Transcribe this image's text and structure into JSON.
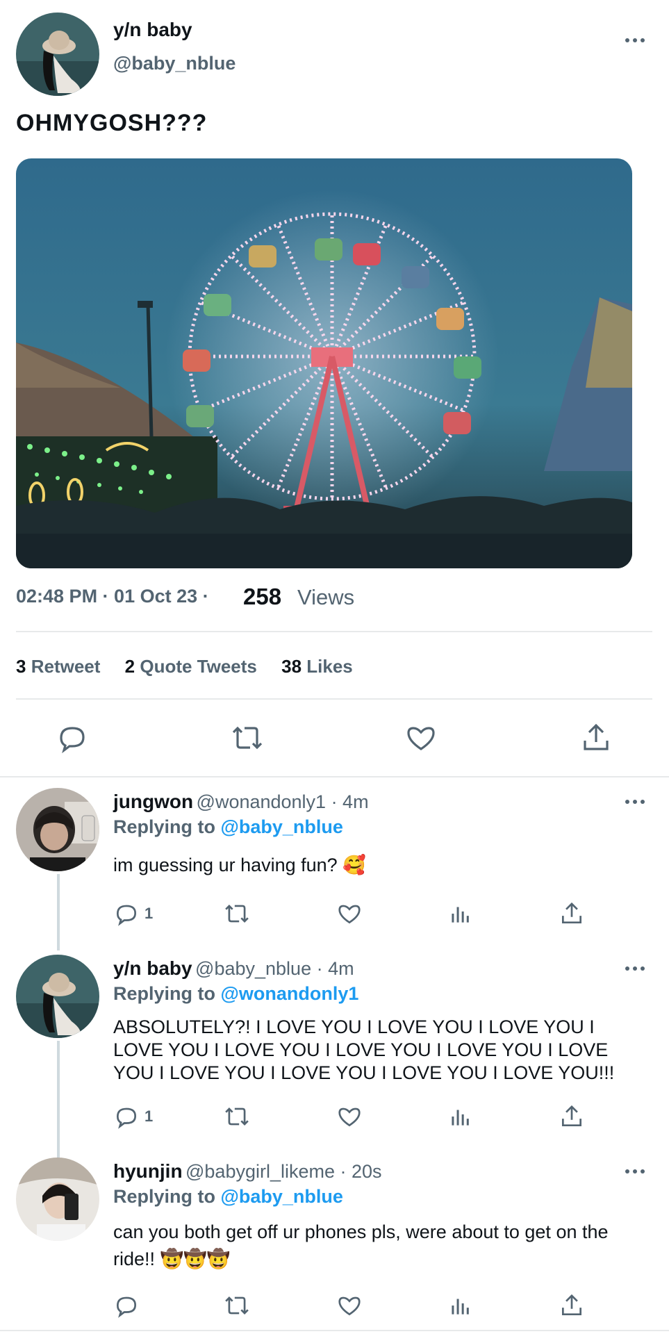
{
  "tweet": {
    "author_name": "y/n baby",
    "author_handle": "@baby_nblue",
    "text": "OHMYGOSH???",
    "time": "02:48 PM · 01 Oct 23 · ",
    "views_count": "258",
    "views_label": "Views",
    "stats": {
      "retweets_count": "3",
      "retweets_label": "Retweet",
      "quotes_count": "2",
      "quotes_label": "Quote Tweets",
      "likes_count": "38",
      "likes_label": "Likes"
    }
  },
  "replies": [
    {
      "name": "jungwon",
      "meta": "@wonandonly1 · 4m",
      "replying_label": "Replying to",
      "replying_to": "@baby_nblue",
      "text": "im guessing ur having fun? 🥰",
      "reply_count": "1"
    },
    {
      "name": "y/n baby",
      "meta": "@baby_nblue · 4m",
      "replying_label": "Replying to",
      "replying_to": "@wonandonly1",
      "text": "ABSOLUTELY?! I LOVE YOU I LOVE YOU I LOVE YOU I LOVE YOU I LOVE YOU I LOVE YOU I LOVE YOU I LOVE YOU I LOVE YOU I LOVE YOU I LOVE YOU I LOVE YOU!!!",
      "reply_count": "1"
    },
    {
      "name": "hyunjin",
      "meta": "@babygirl_likeme · 20s",
      "replying_label": "Replying to",
      "replying_to": "@baby_nblue",
      "text": "can you both get off ur phones pls, were about to get on the ride!! 🤠🤠🤠",
      "reply_count": ""
    }
  ],
  "icons": [
    "more-icon",
    "reply-icon",
    "retweet-icon",
    "like-icon",
    "share-icon",
    "analytics-icon"
  ],
  "colors": {
    "link_blue": "#1d9bf0",
    "secondary_text": "#536471",
    "divider": "#e7e9ea"
  }
}
